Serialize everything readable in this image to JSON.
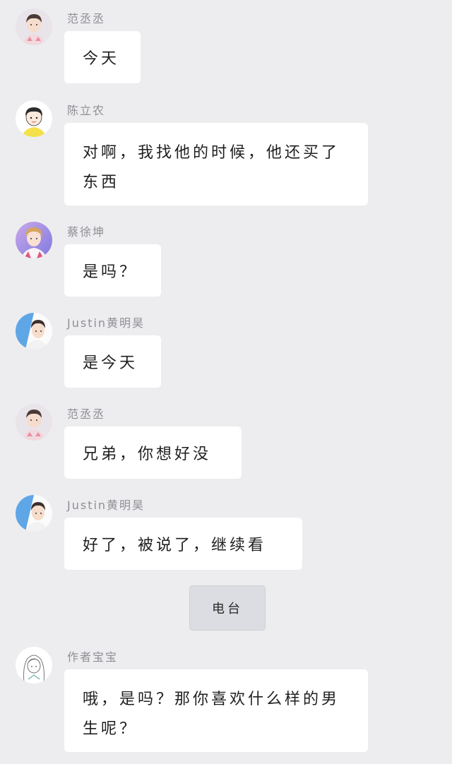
{
  "messages": [
    {
      "sender": "范丞丞",
      "text": "今天",
      "avatar_icon": "boy-portrait-avatar"
    },
    {
      "sender": "陈立农",
      "text": "对啊，我找他的时候，他还买了东西",
      "avatar_icon": "cartoon-boy-avatar"
    },
    {
      "sender": "蔡徐坤",
      "text": "是吗？",
      "avatar_icon": "boy-portrait-avatar"
    },
    {
      "sender": "Justin黄明昊",
      "text": "是今天",
      "avatar_icon": "boy-portrait-avatar"
    },
    {
      "sender": "范丞丞",
      "text": "兄弟，你想好没",
      "avatar_icon": "boy-portrait-avatar"
    },
    {
      "sender": "Justin黄明昊",
      "text": "好了，被说了，继续看",
      "avatar_icon": "boy-portrait-avatar"
    },
    {
      "sender": "作者宝宝",
      "text": "哦，是吗？那你喜欢什么样的男生呢？",
      "avatar_icon": "sketch-girl-avatar"
    }
  ],
  "system_label": "电台",
  "colors": {
    "background": "#ededf0",
    "bubble": "#ffffff",
    "name_text": "#8f8f94",
    "message_text": "#1f1f1f",
    "system_bubble": "#dcdde2"
  }
}
